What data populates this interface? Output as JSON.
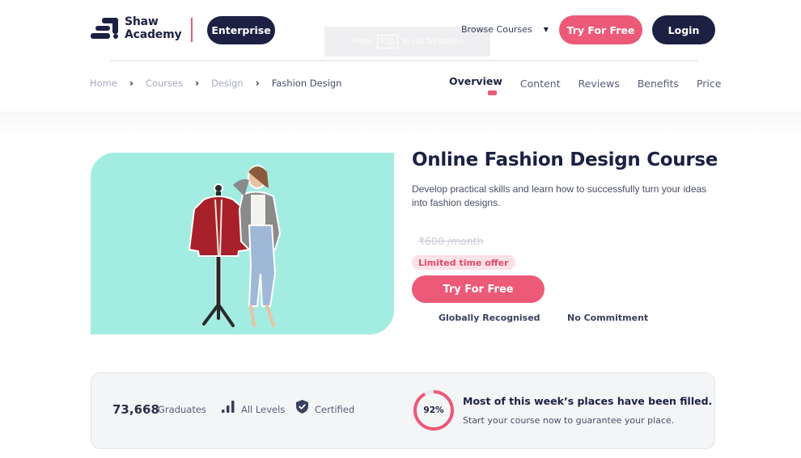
{
  "header": {
    "logo_line1": "Shaw",
    "logo_line2": "Academy",
    "enterprise_label": "Enterprise",
    "browse_label": "Browse Courses",
    "try_label": "Try For Free",
    "login_label": "Login",
    "fullscreen_notice": {
      "prefix": "Press",
      "key": "F11",
      "suffix": "to exit full screen"
    }
  },
  "breadcrumb": [
    {
      "label": "Home"
    },
    {
      "label": "Courses"
    },
    {
      "label": "Design"
    },
    {
      "label": "Fashion Design"
    }
  ],
  "tabs": [
    {
      "label": "Overview",
      "active": true
    },
    {
      "label": "Content"
    },
    {
      "label": "Reviews"
    },
    {
      "label": "Benefits"
    },
    {
      "label": "Price"
    }
  ],
  "course": {
    "title": "Online Fashion Design Course",
    "description": "Develop practical skills and learn how to successfully turn your ideas into fashion designs.",
    "old_price": "₹600 /month",
    "offer_badge": "Limited time offer",
    "cta_label": "Try For Free",
    "features": [
      "Globally Recognised",
      "No Commitment"
    ],
    "hero_image": "woman-with-mannequin-jacket"
  },
  "stats": {
    "graduates_count": "73,668",
    "graduates_label": "Graduates",
    "levels_label": "All Levels",
    "certified_label": "Certified",
    "fill_percent": 92,
    "fill_percent_label": "92%",
    "fill_title": "Most of this week’s places have been filled.",
    "fill_subtitle": "Start your course now to guarantee your place."
  },
  "colors": {
    "brand_navy": "#1c2143",
    "accent_pink": "#ec5a78",
    "hero_bg": "#a3ece1",
    "badge_bg": "#fde1e7"
  }
}
